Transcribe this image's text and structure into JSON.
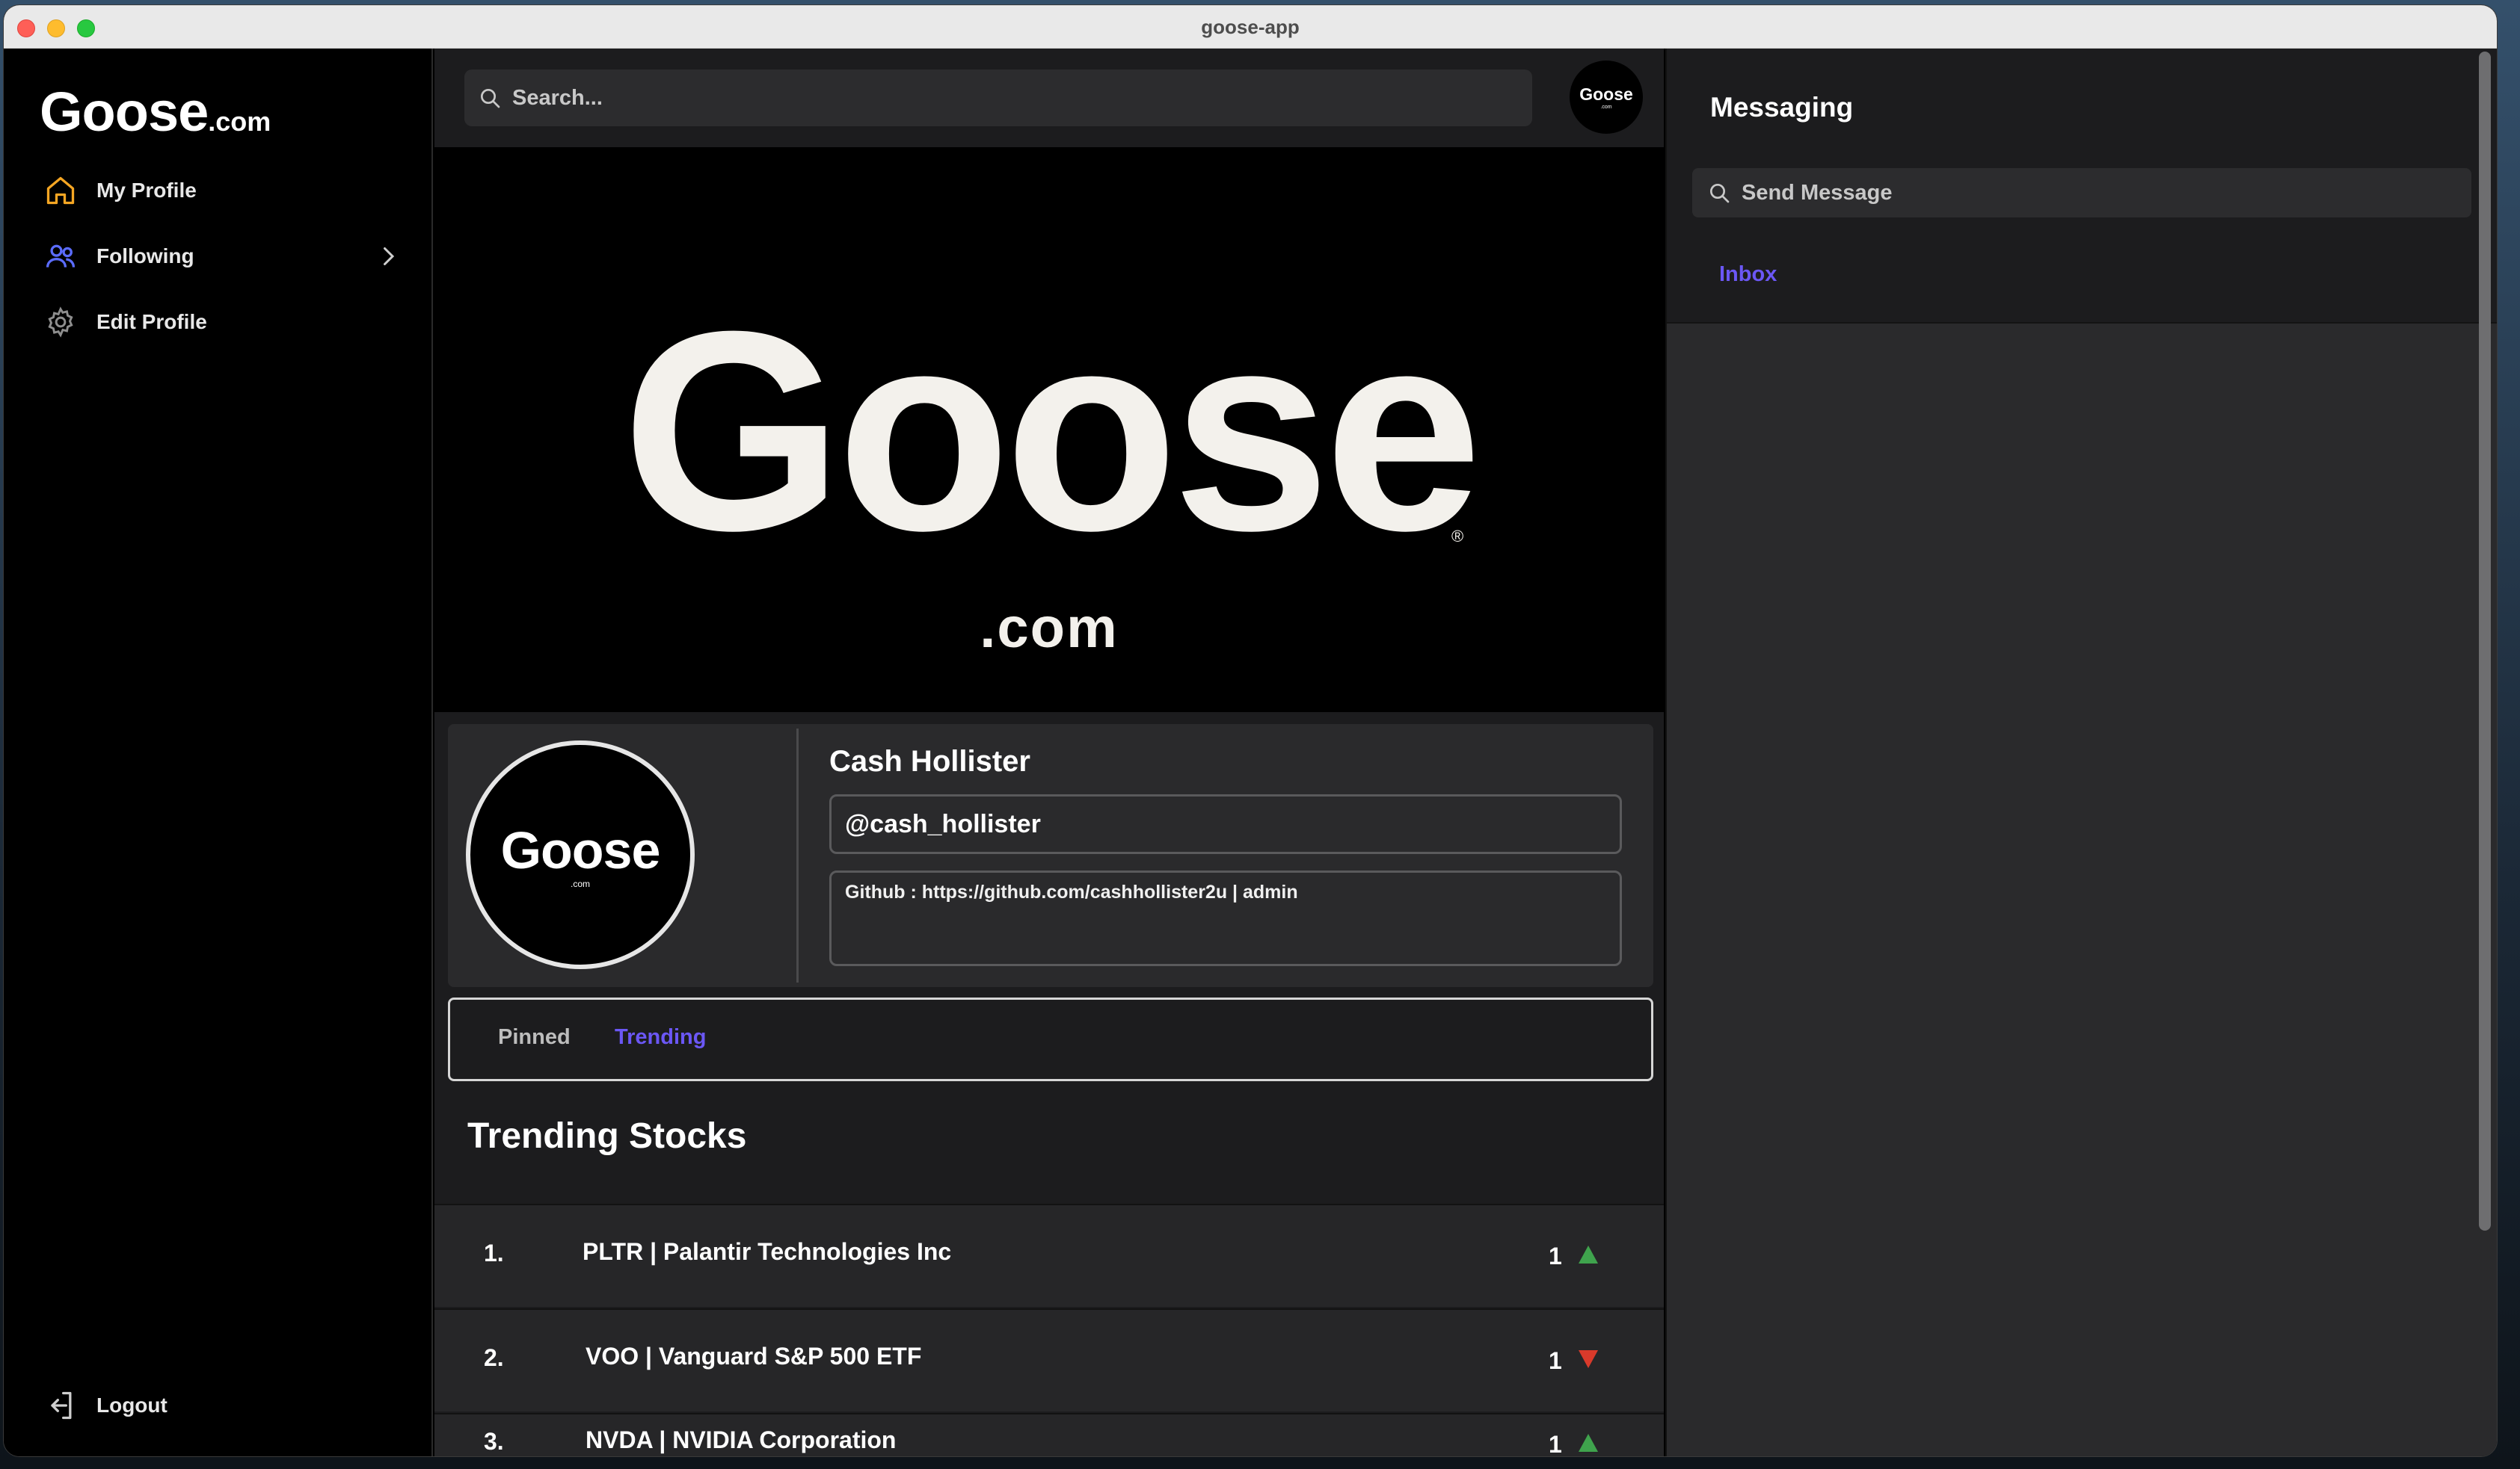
{
  "window": {
    "title": "goose-app"
  },
  "brand": {
    "name": "Goose",
    "suffix": ".com"
  },
  "sidebar": {
    "items": [
      {
        "label": "My Profile",
        "icon": "home-icon",
        "color": "#f5a623"
      },
      {
        "label": "Following",
        "icon": "users-icon",
        "color": "#5b6cff"
      },
      {
        "label": "Edit Profile",
        "icon": "gear-icon",
        "color": "#8e8e8e"
      }
    ],
    "logout_label": "Logout"
  },
  "header": {
    "search_placeholder": "Search...",
    "avatar_text": "Goose",
    "avatar_sub": ".com"
  },
  "banner": {
    "logo_text": "Goose",
    "registered": "®",
    "sub_text": ".com"
  },
  "profile": {
    "name": "Cash Hollister",
    "handle": "@cash_hollister",
    "bio": "Github : https://github.com/cashhollister2u | admin",
    "avatar_text": "Goose",
    "avatar_sub": ".com"
  },
  "tabs": [
    {
      "label": "Pinned",
      "active": false
    },
    {
      "label": "Trending",
      "active": true,
      "color": "#6b57f5"
    }
  ],
  "trending": {
    "title": "Trending Stocks",
    "rows": [
      {
        "rank": "1.",
        "name": "PLTR | Palantir Technologies Inc",
        "count": "1",
        "direction": "up",
        "color": "#3fa34d"
      },
      {
        "rank": "2.",
        "name": "VOO | Vanguard S&P 500 ETF",
        "count": "1",
        "direction": "down",
        "color": "#d93a2b"
      },
      {
        "rank": "3.",
        "name": "NVDA | NVIDIA Corporation",
        "count": "1",
        "direction": "up",
        "color": "#3fa34d"
      }
    ]
  },
  "messaging": {
    "title": "Messaging",
    "search_placeholder": "Send Message",
    "inbox_label": "Inbox"
  }
}
